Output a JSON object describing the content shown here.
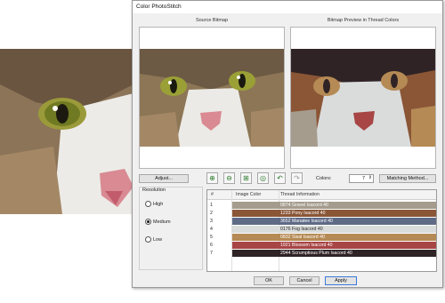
{
  "window": {
    "title": "Color PhotoStitch"
  },
  "captions": {
    "source": "Source Bitmap",
    "preview": "Bitmap Preview in Thread Colors"
  },
  "toolbar": {
    "adjust_label": "Adjust...",
    "tools": [
      {
        "icon": "zoom-in-icon",
        "glyph": "⊕"
      },
      {
        "icon": "zoom-out-icon",
        "glyph": "⊖"
      },
      {
        "icon": "zoom-box-icon",
        "glyph": "⊞"
      },
      {
        "icon": "zoom-fit-icon",
        "glyph": "◎"
      },
      {
        "icon": "undo-icon",
        "glyph": "↶"
      },
      {
        "icon": "redo-icon",
        "glyph": "↷"
      }
    ],
    "colors_label": "Colors:",
    "colors_value": "7",
    "matching_label": "Matching Method..."
  },
  "resolution": {
    "heading": "Resolution",
    "options": [
      {
        "label": "High",
        "selected": false
      },
      {
        "label": "Medium",
        "selected": true
      },
      {
        "label": "Low",
        "selected": false
      }
    ]
  },
  "table": {
    "headers": [
      "#",
      "Image Color",
      "Thread Information"
    ],
    "rows": [
      {
        "num": "1",
        "color": "#a59c8e",
        "info": "0874 Gravel Isacord 40"
      },
      {
        "num": "2",
        "color": "#8a5636",
        "info": "1233 Pony Isacord 40"
      },
      {
        "num": "3",
        "color": "#5e6a86",
        "info": "3652 Manatee Isacord 40"
      },
      {
        "num": "4",
        "color": "#dadcdc",
        "info": "0176 Fog Isacord 40"
      },
      {
        "num": "5",
        "color": "#b58a54",
        "info": "0832 Sisal Isacord 40"
      },
      {
        "num": "6",
        "color": "#a84545",
        "info": "1921 Blossom Isacord 40"
      },
      {
        "num": "7",
        "color": "#2f2326",
        "info": "2944 Scrumptious Plum Isacord 40"
      }
    ]
  },
  "footer": {
    "ok": "OK",
    "cancel": "Cancel",
    "apply": "Apply"
  },
  "colors": {
    "dialog_bg": "#f0f0f0",
    "apply_border": "#3c78d8"
  }
}
